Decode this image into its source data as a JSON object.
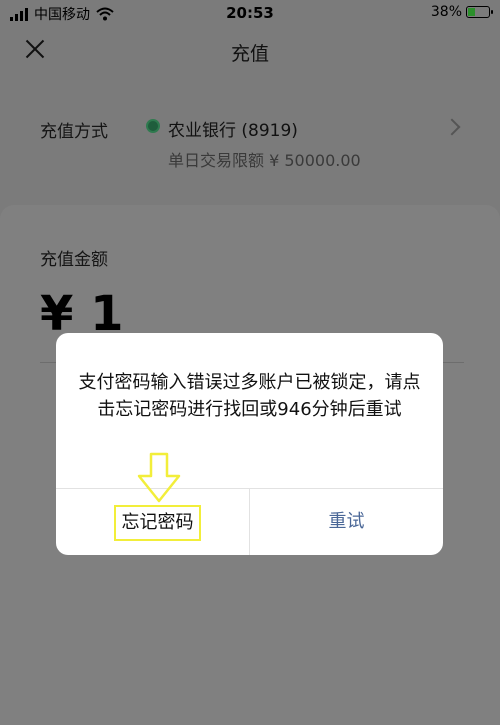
{
  "status_bar": {
    "carrier": "中国移动",
    "time": "20:53",
    "battery_percent": "38%",
    "battery_level": 0.38,
    "icons": [
      "signal-icon",
      "wifi-icon",
      "battery-charging-icon"
    ]
  },
  "nav": {
    "title": "充值",
    "close_icon": "close-icon"
  },
  "payment_method": {
    "label": "充值方式",
    "bank_name": "农业银行 (8919)",
    "limit_text": "单日交易限额 ¥ 50000.00",
    "bank_icon": "abc-bank-icon"
  },
  "amount": {
    "label": "充值金额",
    "value": "¥ 1"
  },
  "dialog": {
    "message": "支付密码输入错误过多账户已被锁定，请点击忘记密码进行找回或946分钟后重试",
    "forget_label": "忘记密码",
    "retry_label": "重试"
  },
  "colors": {
    "overlay_bg": "#7b7b7b",
    "retry_text": "#4a6797",
    "highlight_annotation": "#f2ee3a"
  }
}
